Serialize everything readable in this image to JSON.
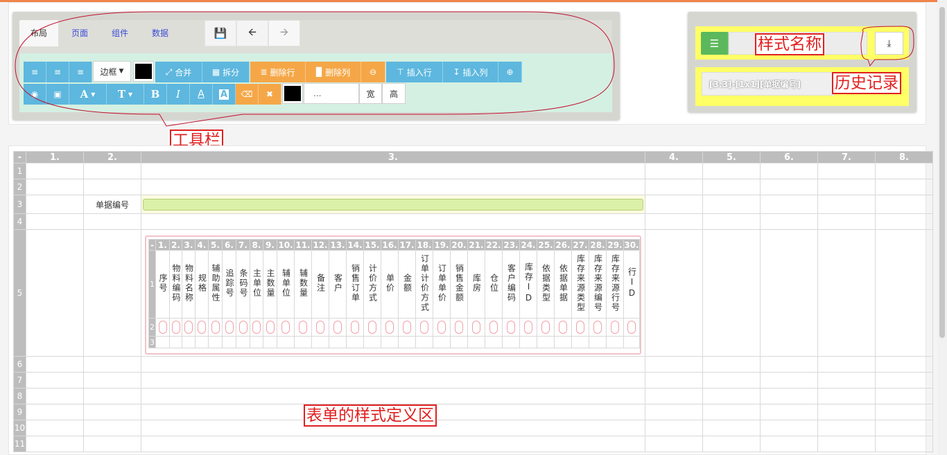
{
  "tabs": [
    "布局",
    "页面",
    "组件",
    "数据"
  ],
  "toolbar": {
    "border_select": "边框",
    "merge": "合并",
    "split": "拆分",
    "delete_row": "删除行",
    "delete_col": "删除列",
    "insert_row": "插入行",
    "insert_col": "插入列",
    "size_placeholder": "...",
    "width": "宽",
    "height": "高",
    "font_a": "A",
    "font_t": "T",
    "bold": "B",
    "italic": "I",
    "under": "A",
    "bg": "A"
  },
  "style_panel": {
    "history_value": "[3:3]-[1x1][单据编号]"
  },
  "annotations": {
    "style_name": "样式名称",
    "history": "历史记录",
    "toolbar": "工具栏",
    "form_area": "表单的样式定义区"
  },
  "grid": {
    "corner": "-",
    "columns": [
      "1.",
      "2.",
      "3.",
      "4.",
      "5.",
      "6.",
      "7.",
      "8."
    ],
    "rows": [
      "1",
      "2",
      "3",
      "4",
      "5",
      "6",
      "7",
      "8",
      "9",
      "10",
      "11"
    ],
    "field_label": "单据编号"
  },
  "inner": {
    "corner": "-",
    "columns": [
      "1.",
      "2.",
      "3.",
      "4.",
      "5.",
      "6.",
      "7.",
      "8.",
      "9.",
      "10.",
      "11.",
      "12.",
      "13.",
      "14.",
      "15.",
      "16.",
      "17.",
      "18.",
      "19.",
      "20.",
      "21.",
      "22.",
      "23.",
      "24.",
      "25.",
      "26.",
      "27.",
      "28.",
      "29.",
      "30."
    ],
    "rows": [
      "1",
      "2",
      "3"
    ],
    "headers": [
      "序号",
      "物料编码",
      "物料名称",
      "规格",
      "辅助属性",
      "追踪号",
      "条码号",
      "主单位",
      "主数量",
      "辅单位",
      "辅数量",
      "备注",
      "客户",
      "销售订单",
      "计价方式",
      "单价",
      "金额",
      "订单计价方式",
      "订单单价",
      "销售金额",
      "库房",
      "仓位",
      "客户编码",
      "库存ID",
      "依据类型",
      "依据单据",
      "库存来源类型",
      "库存来源编号",
      "库存来源行号",
      "行ID"
    ]
  },
  "colors": {
    "blue": "#5db7de",
    "orange": "#f5a748",
    "green": "#5cb85c",
    "annotation": "#e02020",
    "highlight": "#ffff66"
  }
}
